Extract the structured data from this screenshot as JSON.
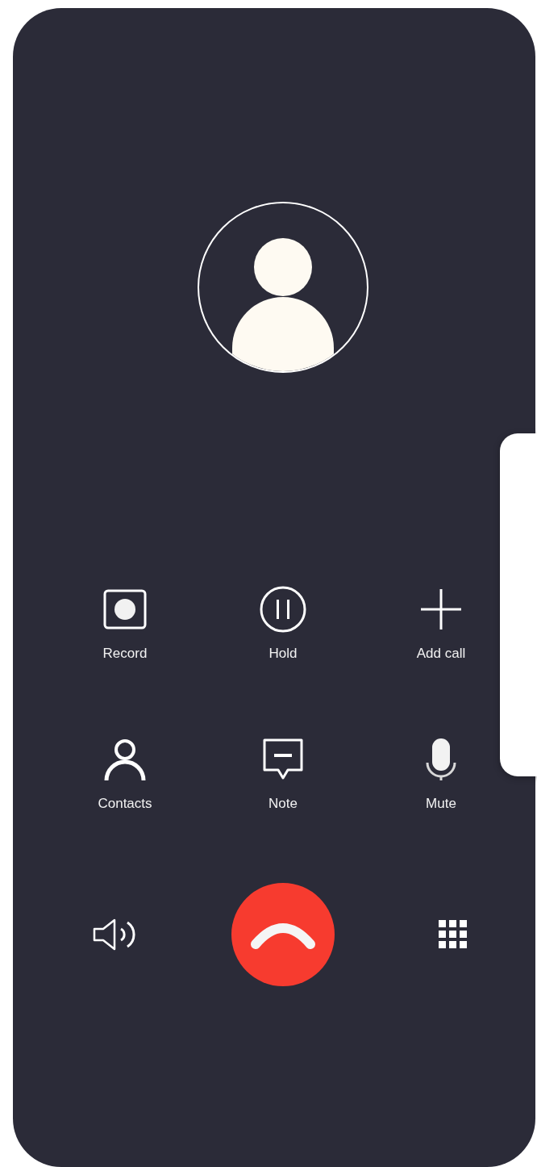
{
  "actions": [
    {
      "kind": "record",
      "label": "Record"
    },
    {
      "kind": "hold",
      "label": "Hold"
    },
    {
      "kind": "add",
      "label": "Add call"
    },
    {
      "kind": "contacts",
      "label": "Contacts"
    },
    {
      "kind": "note",
      "label": "Note"
    },
    {
      "kind": "mute",
      "label": "Mute"
    }
  ],
  "bottom": [
    {
      "kind": "speaker"
    },
    {
      "kind": "end"
    },
    {
      "kind": "keypad"
    }
  ]
}
